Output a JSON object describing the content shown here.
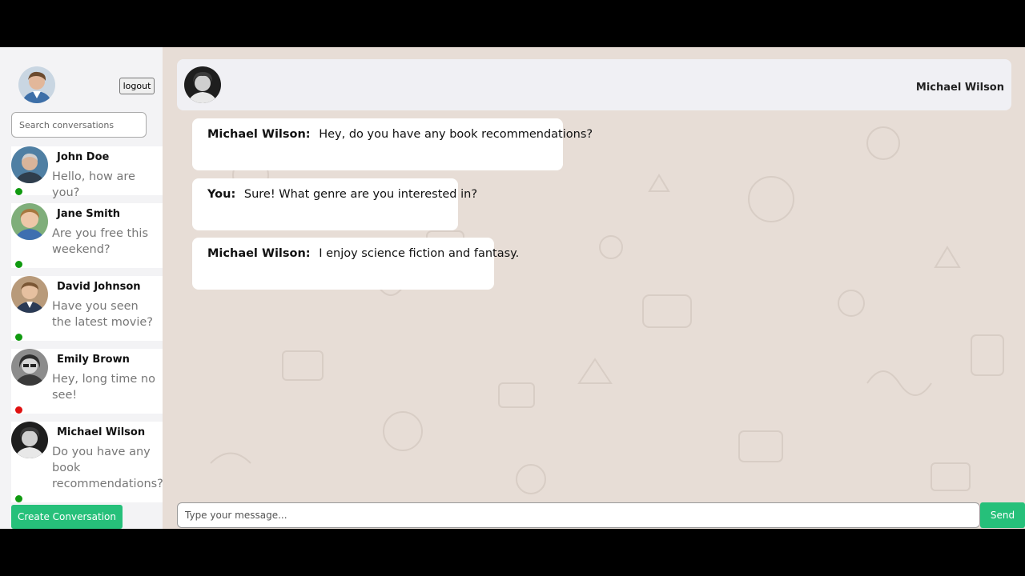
{
  "sidebar": {
    "logout_label": "logout",
    "search_placeholder": "Search conversations",
    "create_label": "Create Conversation",
    "conversations": [
      {
        "name": "John Doe",
        "last_message": "Hello, how are you?",
        "status": "online",
        "status_color": "#109a10",
        "avatar_color": "#5d8aa8"
      },
      {
        "name": "Jane Smith",
        "last_message": "Are you free this weekend?",
        "status": "online",
        "status_color": "#109a10",
        "avatar_color": "#6aa56a"
      },
      {
        "name": "David Johnson",
        "last_message": "Have you seen the latest movie?",
        "status": "online",
        "status_color": "#109a10",
        "avatar_color": "#8a6d5a"
      },
      {
        "name": "Emily Brown",
        "last_message": "Hey, long time no see!",
        "status": "offline",
        "status_color": "#e01010",
        "avatar_color": "#6e6e6e"
      },
      {
        "name": "Michael Wilson",
        "last_message": "Do you have any book recommendations?",
        "status": "online",
        "status_color": "#109a10",
        "avatar_color": "#2c2c2c"
      }
    ]
  },
  "chat": {
    "contact_name": "Michael Wilson",
    "messages": [
      {
        "sender": "Michael Wilson:",
        "text": "Hey, do you have any book recommendations?"
      },
      {
        "sender": "You:",
        "text": "Sure! What genre are you interested in?"
      },
      {
        "sender": "Michael Wilson:",
        "text": "I enjoy science fiction and fantasy."
      }
    ],
    "input_placeholder": "Type your message...",
    "send_label": "Send"
  },
  "colors": {
    "accent": "#26c07a",
    "chat_background": "#e7ddd6",
    "online": "#109a10",
    "offline": "#e01010"
  }
}
